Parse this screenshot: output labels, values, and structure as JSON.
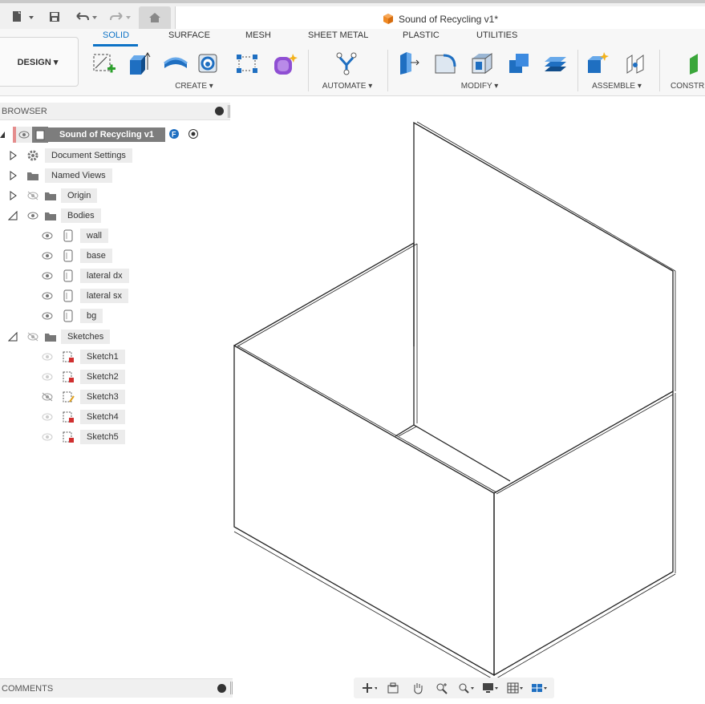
{
  "app": {
    "document_title": "Sound of Recycling v1*",
    "workspace_button": "DESIGN ▾"
  },
  "ribbon": {
    "tabs": [
      "SOLID",
      "SURFACE",
      "MESH",
      "SHEET METAL",
      "PLASTIC",
      "UTILITIES"
    ],
    "active_tab": "SOLID",
    "groups": [
      "CREATE ▾",
      "AUTOMATE ▾",
      "MODIFY ▾",
      "ASSEMBLE ▾",
      "CONSTR"
    ]
  },
  "browser": {
    "title": "BROWSER",
    "root": "Sound of Recycling v1",
    "items": {
      "document_settings": "Document Settings",
      "named_views": "Named Views",
      "origin": "Origin",
      "bodies": "Bodies",
      "sketches": "Sketches"
    },
    "bodies": [
      "wall",
      "base",
      "lateral dx",
      "lateral sx",
      "bg"
    ],
    "sketches": [
      "Sketch1",
      "Sketch2",
      "Sketch3",
      "Sketch4",
      "Sketch5"
    ]
  },
  "comments": {
    "title": "COMMENTS"
  },
  "colors": {
    "accent": "#0d72c6",
    "doc_icon": "#f08a24",
    "sketch_lock": "#d03030"
  }
}
